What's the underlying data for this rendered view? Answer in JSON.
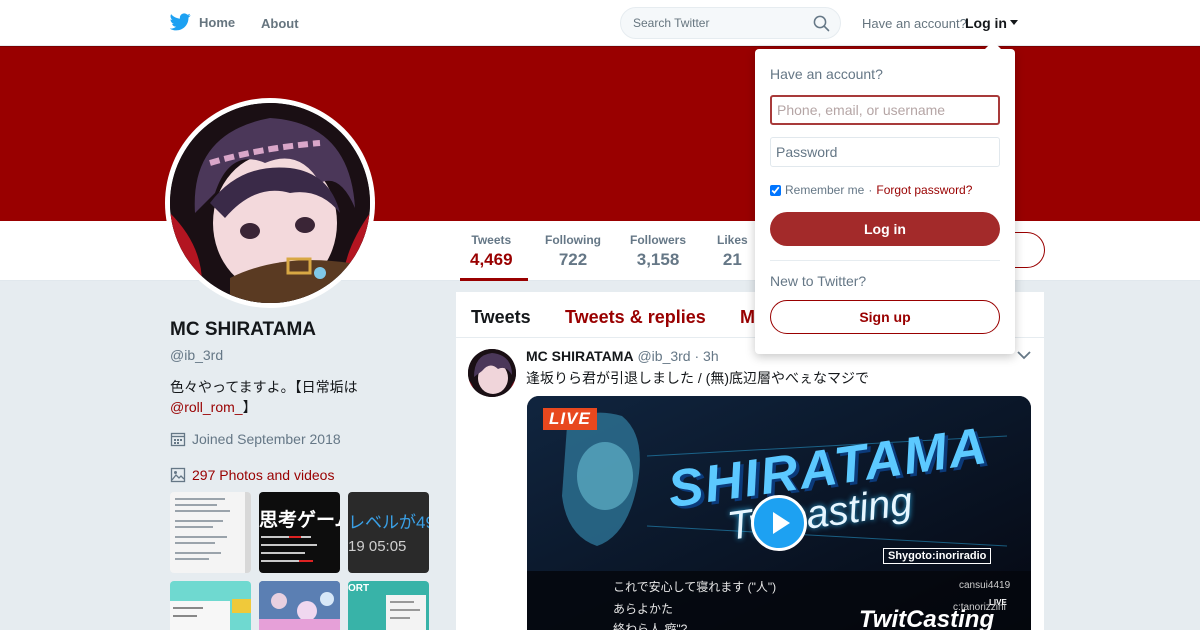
{
  "nav": {
    "home_label": "Home",
    "about_label": "About",
    "search_placeholder": "Search Twitter",
    "have_account": "Have an account?",
    "login_label": "Log in"
  },
  "profile": {
    "name": "MC SHIRATAMA",
    "handle": "@ib_3rd",
    "bio_text": "色々やってますよ。【日常垢は",
    "bio_mention": "@roll_rom_",
    "bio_end": "】",
    "joined": "Joined September 2018",
    "photos": "297 Photos and videos"
  },
  "stats": [
    {
      "label": "Tweets",
      "value": "4,469"
    },
    {
      "label": "Following",
      "value": "722"
    },
    {
      "label": "Followers",
      "value": "3,158"
    },
    {
      "label": "Likes",
      "value": "21"
    }
  ],
  "tabs": [
    "Tweets",
    "Tweets & replies",
    "M"
  ],
  "tweet": {
    "name": "MC SHIRATAMA",
    "handle": "@ib_3rd",
    "time": "· 3h",
    "text": "逢坂りら君が引退しました / (無)底辺層やべぇなマジで",
    "media": {
      "live_badge": "LIVE",
      "logo_line1": "SHIRATAMA",
      "logo_line2": "Twicasting",
      "sub_tag": "Shygoto:inoriradio",
      "comment1": "これで安心して寝れます (\"人\")",
      "comment2": "あらよかた",
      "comment3": "終わら人 癖\"?",
      "user1": "cansui4419",
      "user2": "c:tanorizzini",
      "brand": "TwitCasting",
      "brand_live": "LIVE"
    }
  },
  "thumbs": {
    "t2_line": "思考ゲーム",
    "t3_line1": "レベルが49",
    "t3_line2": "19 05:05",
    "t6_label": "ORT"
  },
  "login_dropdown": {
    "title": "Have an account?",
    "username_placeholder": "Phone, email, or username",
    "password_placeholder": "Password",
    "remember": "Remember me",
    "dot": "·",
    "forgot": "Forgot password?",
    "login_button": "Log in",
    "new_to": "New to Twitter?",
    "signup_button": "Sign up"
  },
  "colors": {
    "brand": "#990000",
    "twitter_blue": "#1da1f2",
    "button": "#a32a2a"
  }
}
